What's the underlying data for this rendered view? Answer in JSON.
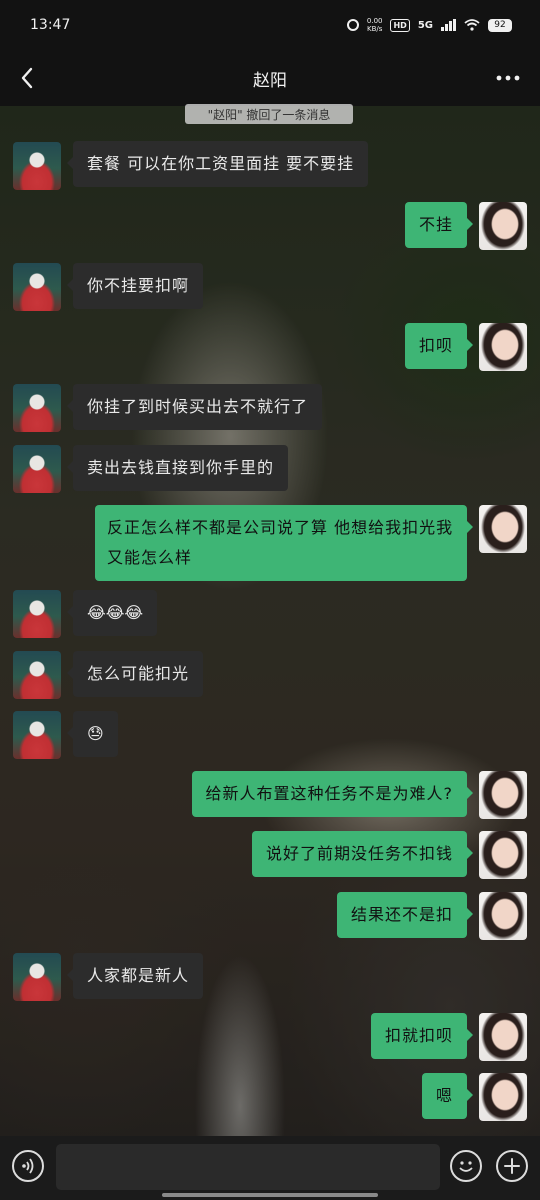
{
  "status_bar": {
    "time": "13:47",
    "net_speed_value": "0.00",
    "net_speed_unit": "KB/s",
    "hd_label": "HD",
    "network_label": "5G",
    "battery_level": "92",
    "icons": [
      "alarm-icon",
      "hd-icon",
      "signal-icon",
      "wifi-icon",
      "battery-icon"
    ]
  },
  "header": {
    "title": "赵阳",
    "back_icon": "chevron-left-icon",
    "more_icon": "more-icon"
  },
  "system_notice": "\"赵阳\" 撤回了一条消息",
  "messages": [
    {
      "sender": "them",
      "text": "套餐 可以在你工资里面挂 要不要挂"
    },
    {
      "sender": "me",
      "text": "不挂"
    },
    {
      "sender": "them",
      "text": "你不挂要扣啊"
    },
    {
      "sender": "me",
      "text": "扣呗"
    },
    {
      "sender": "them",
      "text": "你挂了到时候买出去不就行了"
    },
    {
      "sender": "them",
      "text": "卖出去钱直接到你手里的"
    },
    {
      "sender": "me",
      "text": "反正怎么样不都是公司说了算 他想给我扣光我又能怎么样"
    },
    {
      "sender": "them",
      "text": "😂😂😂"
    },
    {
      "sender": "them",
      "text": "怎么可能扣光"
    },
    {
      "sender": "them",
      "text": "😓"
    },
    {
      "sender": "me",
      "text": "给新人布置这种任务不是为难人?"
    },
    {
      "sender": "me",
      "text": "说好了前期没任务不扣钱"
    },
    {
      "sender": "me",
      "text": "结果还不是扣"
    },
    {
      "sender": "them",
      "text": "人家都是新人"
    },
    {
      "sender": "me",
      "text": "扣就扣呗"
    },
    {
      "sender": "me",
      "text": "嗯"
    }
  ],
  "input_bar": {
    "voice_icon": "voice-icon",
    "emoji_icon": "emoji-icon",
    "plus_icon": "plus-icon",
    "text_value": ""
  },
  "colors": {
    "outgoing_bubble": "#3eb575",
    "incoming_bubble": "#2c2c2c",
    "background": "#121212"
  }
}
